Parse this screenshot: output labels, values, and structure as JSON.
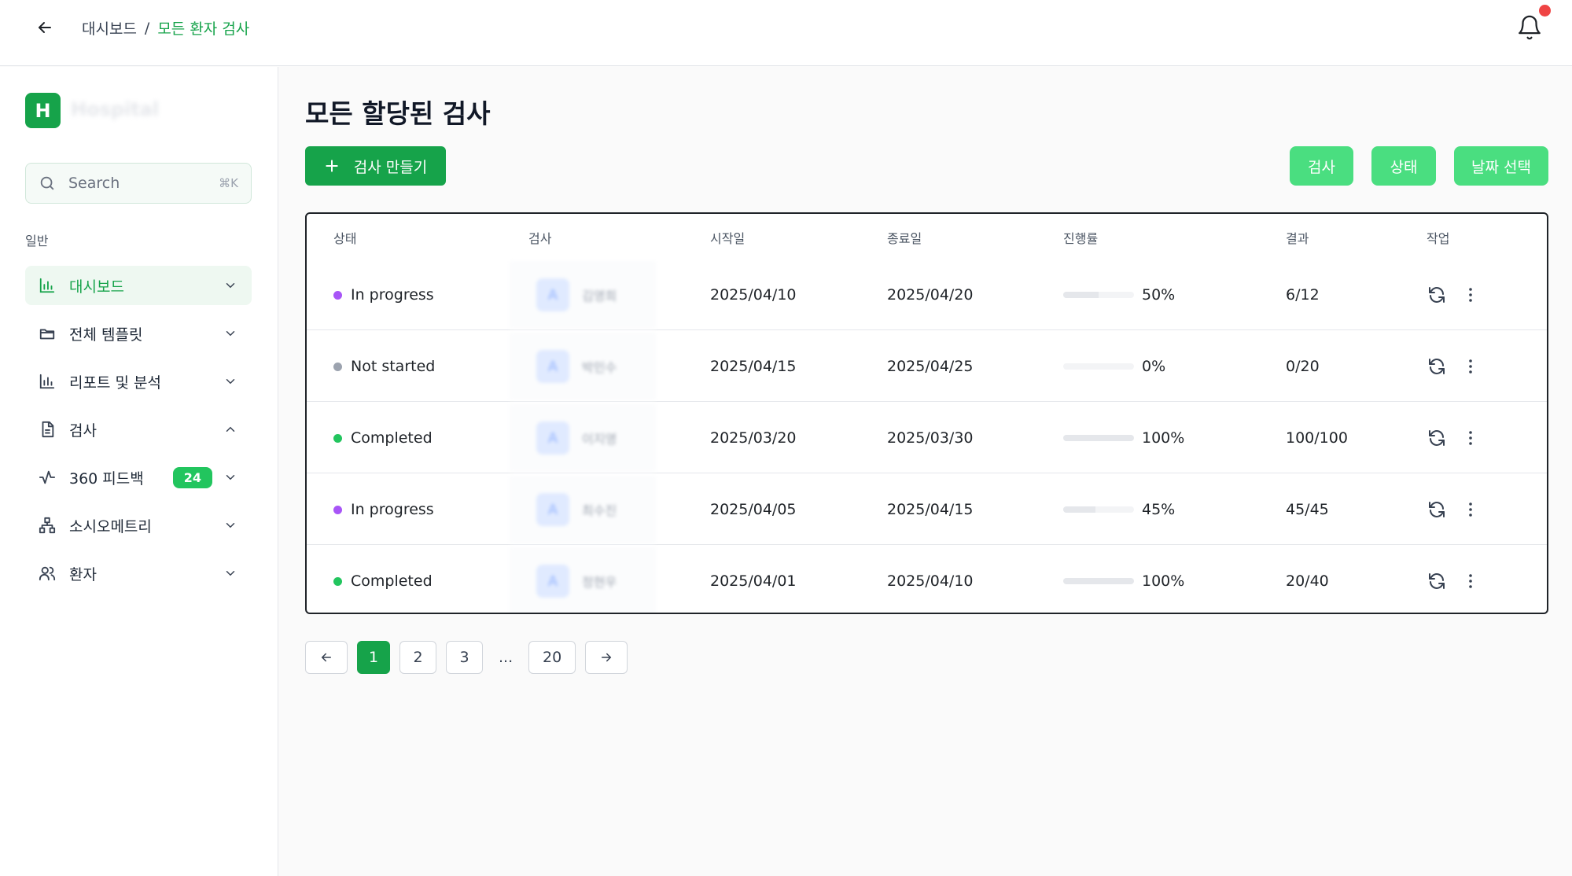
{
  "breadcrumb": {
    "root": "대시보드",
    "separator": "/",
    "current": "모든 환자 검사"
  },
  "brand": {
    "logo_letter": "H",
    "name": "Hospital",
    "accent": "#16a34a"
  },
  "sidebar": {
    "search_placeholder": "Search",
    "search_shortcut": "⌘K",
    "section_label": "일반",
    "items": [
      {
        "label": "대시보드",
        "icon": "bar-chart-icon",
        "active": true,
        "expanded": false
      },
      {
        "label": "전체 템플릿",
        "icon": "folder-icon",
        "expanded": false
      },
      {
        "label": "리포트 및 분석",
        "icon": "bar-chart-icon",
        "expanded": false
      },
      {
        "label": "검사",
        "icon": "document-icon",
        "expanded": true
      },
      {
        "label": "360 피드백",
        "icon": "activity-icon",
        "badge": "24",
        "expanded": false
      },
      {
        "label": "소시오메트리",
        "icon": "network-icon",
        "expanded": false
      },
      {
        "label": "환자",
        "icon": "users-icon",
        "expanded": false
      }
    ]
  },
  "main": {
    "title": "모든 할당된 검사",
    "create_button": "검사 만들기",
    "filters": {
      "test": "검사",
      "status": "상태",
      "date": "날짜 선택"
    },
    "table": {
      "headers": {
        "status": "상태",
        "test": "검사",
        "start": "시작일",
        "end": "종료일",
        "progress": "진행률",
        "result": "결과",
        "action": "작업"
      },
      "rows": [
        {
          "status": "In progress",
          "status_color": "#a855f7",
          "avatar": "A",
          "name": "김영희",
          "start": "2025/04/10",
          "end": "2025/04/20",
          "progress_label": "50%",
          "progress": 0.5,
          "result": "6/12"
        },
        {
          "status": "Not started",
          "status_color": "#9ca3af",
          "avatar": "A",
          "name": "박민수",
          "start": "2025/04/15",
          "end": "2025/04/25",
          "progress_label": "0%",
          "progress": 0,
          "result": "0/20"
        },
        {
          "status": "Completed",
          "status_color": "#22c55e",
          "avatar": "A",
          "name": "이지영",
          "start": "2025/03/20",
          "end": "2025/03/30",
          "progress_label": "100%",
          "progress": 1,
          "result": "100/100"
        },
        {
          "status": "In progress",
          "status_color": "#a855f7",
          "avatar": "A",
          "name": "최수진",
          "start": "2025/04/05",
          "end": "2025/04/15",
          "progress_label": "45%",
          "progress": 0.45,
          "result": "45/45"
        },
        {
          "status": "Completed",
          "status_color": "#22c55e",
          "avatar": "A",
          "name": "정현우",
          "start": "2025/04/01",
          "end": "2025/04/10",
          "progress_label": "100%",
          "progress": 1,
          "result": "20/40"
        }
      ]
    },
    "pagination": {
      "pages": [
        "1",
        "2",
        "3"
      ],
      "ellipsis": "...",
      "last": "20",
      "current": "1"
    }
  }
}
